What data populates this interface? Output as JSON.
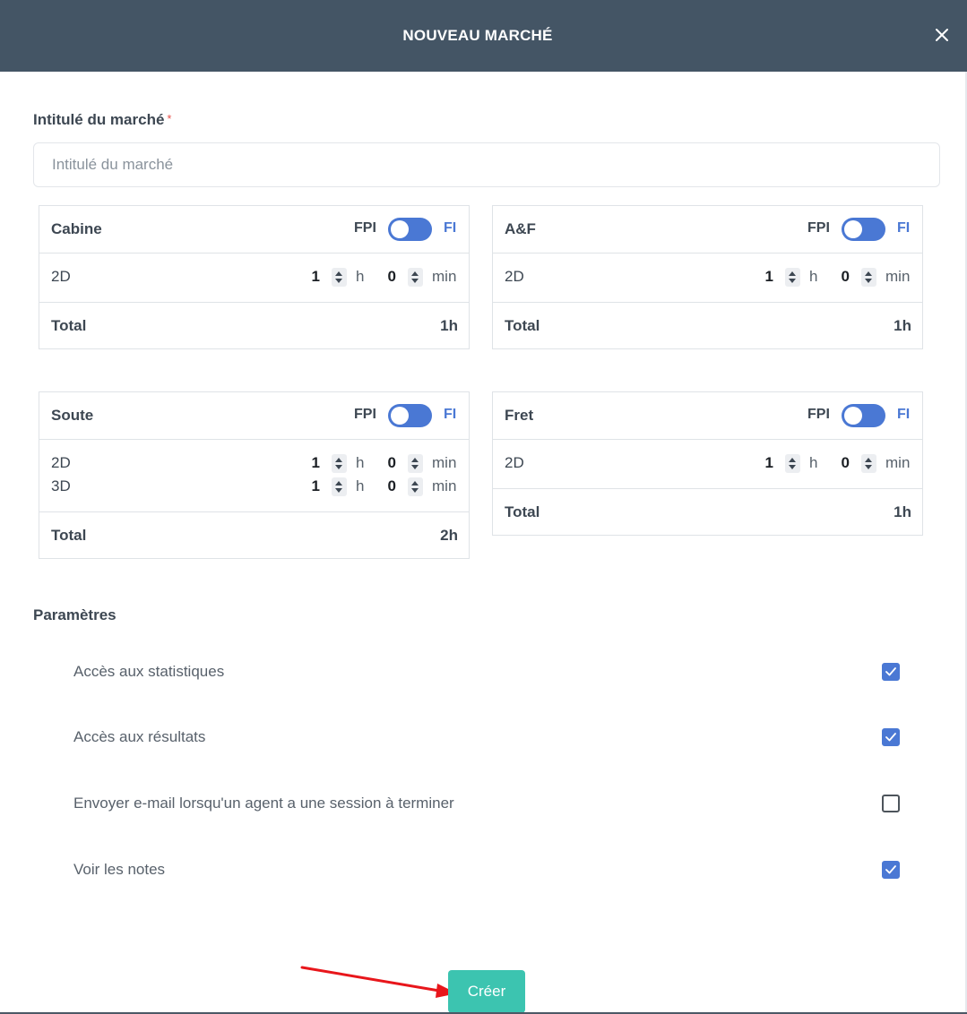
{
  "modal": {
    "title": "NOUVEAU MARCHÉ",
    "close_icon": "close-icon"
  },
  "title_field": {
    "label": "Intitulé du marché",
    "required_mark": "*",
    "placeholder": "Intitulé du marché",
    "value": ""
  },
  "toggle_labels": {
    "left": "FPI",
    "right": "FI"
  },
  "units": {
    "hours": "h",
    "minutes": "min"
  },
  "total_label": "Total",
  "cards": [
    {
      "name": "Cabine",
      "toggle_on": true,
      "rows": [
        {
          "label": "2D",
          "hours": "1",
          "minutes": "0"
        }
      ],
      "total": "1h"
    },
    {
      "name": "A&F",
      "toggle_on": true,
      "rows": [
        {
          "label": "2D",
          "hours": "1",
          "minutes": "0"
        }
      ],
      "total": "1h"
    },
    {
      "name": "Soute",
      "toggle_on": true,
      "rows": [
        {
          "label": "2D",
          "hours": "1",
          "minutes": "0"
        },
        {
          "label": "3D",
          "hours": "1",
          "minutes": "0"
        }
      ],
      "total": "2h"
    },
    {
      "name": "Fret",
      "toggle_on": true,
      "rows": [
        {
          "label": "2D",
          "hours": "1",
          "minutes": "0"
        }
      ],
      "total": "1h"
    }
  ],
  "params": {
    "title": "Paramètres",
    "items": [
      {
        "label": "Accès aux statistiques",
        "checked": true
      },
      {
        "label": "Accès aux résultats",
        "checked": true
      },
      {
        "label": "Envoyer e-mail lorsqu'un agent a une session à terminer",
        "checked": false
      },
      {
        "label": "Voir les notes",
        "checked": true
      }
    ]
  },
  "actions": {
    "create_label": "Créer"
  },
  "colors": {
    "header_bg": "#445565",
    "accent_blue": "#4a78d4",
    "create_button": "#3cc4b0",
    "annotation_arrow": "#e8161b"
  }
}
